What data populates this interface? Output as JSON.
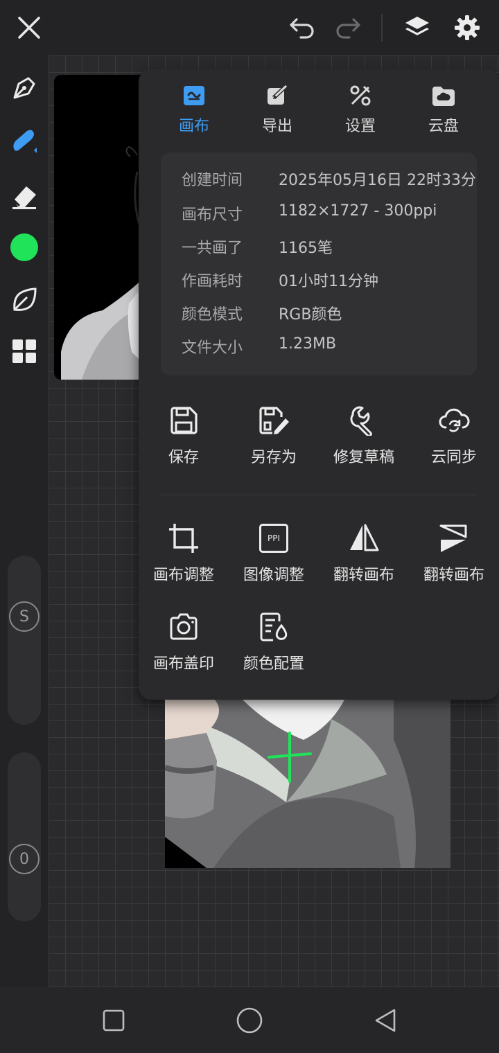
{
  "colors": {
    "accent": "#3e9cf2",
    "current_color": "#20e35a",
    "panel_bg": "#2a2a2c",
    "app_bg": "#232325"
  },
  "topbar": {
    "close_icon": "close-icon",
    "undo_icon": "undo-icon",
    "redo_icon": "redo-icon",
    "layers_icon": "layers-icon",
    "settings_icon": "gear-icon"
  },
  "sidebar": {
    "tools": [
      "pen-nib-icon",
      "brush-icon",
      "eraser-icon",
      "color-swatch",
      "leaf-icon",
      "grid-apps-icon"
    ],
    "size_slider_label": "S",
    "opacity_slider_label": "0"
  },
  "panel": {
    "tabs": [
      {
        "label": "画布",
        "icon": "canvas-icon",
        "active": true
      },
      {
        "label": "导出",
        "icon": "export-icon",
        "active": false
      },
      {
        "label": "设置",
        "icon": "tools-icon",
        "active": false
      },
      {
        "label": "云盘",
        "icon": "cloud-folder-icon",
        "active": false
      }
    ],
    "info": [
      {
        "label": "创建时间",
        "value": "2025年05月16日 22时33分"
      },
      {
        "label": "画布尺寸",
        "value": "1182×1727 - 300ppi"
      },
      {
        "label": "一共画了",
        "value": "1165笔"
      },
      {
        "label": "作画耗时",
        "value": "01小时11分钟"
      },
      {
        "label": "颜色模式",
        "value": "RGB颜色"
      },
      {
        "label": "文件大小",
        "value": "1.23MB"
      }
    ],
    "actions_row1": [
      {
        "label": "保存",
        "icon": "save-icon"
      },
      {
        "label": "另存为",
        "icon": "save-as-icon"
      },
      {
        "label": "修复草稿",
        "icon": "wrench-icon"
      },
      {
        "label": "云同步",
        "icon": "cloud-sync-icon"
      }
    ],
    "actions_row2": [
      {
        "label": "画布调整",
        "icon": "crop-icon"
      },
      {
        "label": "图像调整",
        "icon": "ppi-icon",
        "icon_text": "PPI"
      },
      {
        "label": "翻转画布",
        "icon": "flip-horizontal-icon"
      },
      {
        "label": "翻转画布",
        "icon": "flip-vertical-icon"
      }
    ],
    "actions_row3": [
      {
        "label": "画布盖印",
        "icon": "camera-icon"
      },
      {
        "label": "颜色配置",
        "icon": "color-config-icon"
      }
    ]
  },
  "navbar": {
    "buttons": [
      "recent-apps-icon",
      "home-icon",
      "back-icon"
    ]
  }
}
